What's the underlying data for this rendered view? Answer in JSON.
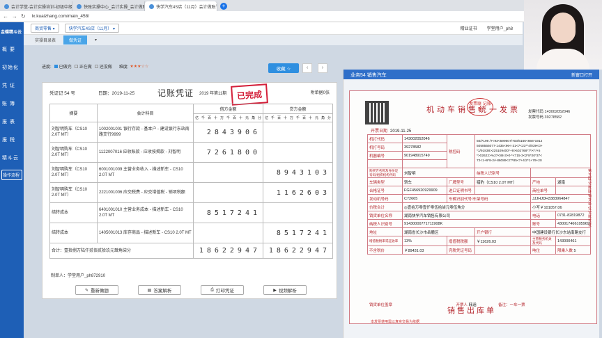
{
  "browser": {
    "tabs": [
      {
        "label": "会计学堂-会计实操培训-初级中级",
        "active": false
      },
      {
        "label": "快账实操中心_会计实操_会计做账",
        "active": false
      },
      {
        "label": "快学汽车4S店（11月）会计做账",
        "active": true
      }
    ],
    "new_tab_glyph": "+",
    "url": "lx.kuaizhang.com/main_458/",
    "back_glyph": "←",
    "forward_glyph": "→",
    "reload_glyph": "↻"
  },
  "sidebar": {
    "logo": "金蝶精斗云",
    "items": [
      "概 要",
      "初始化",
      "凭 证",
      "账 簿",
      "报 表",
      "报 税",
      "精斗云"
    ],
    "process_button": "操作流程"
  },
  "topbar": {
    "mode": "商贸零售",
    "company": "快学汽车4S店（11月）",
    "right_items": [
      "精业证书",
      "学堂用户_ph8"
    ]
  },
  "subtabs": [
    "实操目录表",
    "做凭证"
  ],
  "progress": {
    "label": "进度:",
    "done": "已做完",
    "in_progress": "正在做",
    "not_done": "还没做",
    "difficulty_label": "难度:",
    "stars": "★★★☆☆"
  },
  "collect_button": "收藏 ☆",
  "pager": {
    "prev": "‹",
    "next": "›"
  },
  "voucher": {
    "no": "凭证记 54 号",
    "date": "日期：2019-11-25",
    "title": "记账凭证",
    "period": "2019 年第11期",
    "attachments": "附单据0张",
    "stamp": "已完成",
    "headers": {
      "summary": "摘要",
      "account": "会计科目",
      "debit": "借方金额",
      "credit": "贷方金额"
    },
    "digits": [
      "亿",
      "千",
      "百",
      "十",
      "万",
      "千",
      "百",
      "十",
      "元",
      "角",
      "分"
    ],
    "rows": [
      {
        "summary": "刘智明购车（CS10 2.0T MT）",
        "account": "1002001001 银行存款 - 基本户 - 建设银行东站南路支行9999",
        "debit": "2843906",
        "credit": ""
      },
      {
        "summary": "刘智明购车（CS10 2.0T MT）",
        "account": "1122007016 应收账款 - 应收按揭款 - 刘智明",
        "debit": "7261800",
        "credit": ""
      },
      {
        "summary": "刘智明购车（CS10 2.0T MT）",
        "account": "6001001009 主营业务收入 - 描述新车 - CS10 2.0T MT",
        "debit": "",
        "credit": "8943103"
      },
      {
        "summary": "刘智明购车（CS10 2.0T MT）",
        "account": "2221001006 应交税费 - 应交增值税 - 销项税额",
        "debit": "",
        "credit": "1162603"
      },
      {
        "summary": "结转成本",
        "account": "6401001010 主营业务成本 - 描述新车 - CS10 2.0T MT",
        "debit": "8517241",
        "credit": ""
      },
      {
        "summary": "结转成本",
        "account": "1405001013 库存商品 - 描述新车 - CS10 2.0T MT",
        "debit": "",
        "credit": "8517241"
      }
    ],
    "total_label": "合计：壹拾捌万陆仟贰佰贰拾玖元肆角柒分",
    "total_debit": "18622947",
    "total_credit": "18622947",
    "maker": "制单人：学堂用户_ph872910"
  },
  "actions": [
    {
      "label": "重新做题",
      "icon": "✎"
    },
    {
      "label": "答案解析",
      "icon": "▤"
    },
    {
      "label": "打印凭证",
      "icon": "⎙"
    },
    {
      "label": "视频解析",
      "icon": "▶"
    }
  ],
  "invoice_panel": {
    "header": "业务54 销售汽车",
    "header_right": "新窗口打开",
    "title": "机动车销售统一发票",
    "seal": "发票联 记账联",
    "codes": [
      "发票代码 143002052046",
      "发票号码 39278582"
    ],
    "issue_date_label": "开票日期",
    "issue_date": "2019-11-25",
    "machine_code_label": "机打代码",
    "machine_code": "143002052046",
    "machine_no_label": "机打号码",
    "machine_no": "39278582",
    "device_label": "机器编号",
    "device": "901948915749",
    "tax_area_label": "税控码",
    "tax_area": [
      "50/7199 /7<93<599607/703/6166<666*1912",
      "5058555077-1435<96<-31<7<23**4/039<0>",
      "*1/91838>225109400*+9>502768*7*/<*/+5",
      "*>02622>%27<88-3>0-*<715-3<2*8*20*37<",
      "72<1+6*8-2/+86089<27*85<7+4/2*1+79+20"
    ],
    "buyer_label": "购买方名称及身份证号码/组织机构代码",
    "buyer": "刘智明",
    "tax_id_label": "纳税人识别号",
    "vehicle_type_label": "车辆类型",
    "vehicle_type": "轿车",
    "brand_label": "厂牌型号",
    "brand": "猎豹（CS10 2.0T MT）",
    "origin_label": "产地",
    "origin": "湖南",
    "cert_label": "合格证号",
    "cert": "FGF456920929909",
    "import_label": "进口证明书号",
    "inspect_label": "商检单号",
    "engine_label": "发动机号码",
    "engine": "C72665",
    "vin_label": "车辆识别代号/车架号码",
    "vin": "JJJHJDH3383964847",
    "amount_label": "价税合计",
    "amount_text": "◎壹拾万零壹仟零伍拾柒元零伍角分",
    "amount_small": "小写￥101057.06",
    "seller_label": "销货单位名称",
    "seller": "湖南快学汽车销售有限公司",
    "phone_label": "电话",
    "phone": "0731-82819872",
    "seller_tax_label": "纳税人识别号",
    "seller_tax": "91430000771711908K",
    "account_label": "账号",
    "account": "43001746610596999999",
    "address_label": "地址",
    "address": "湖南省长沙市岳麓区",
    "bank_label": "开户银行",
    "bank": "中国建设银行长沙东站南路支行",
    "vat_rate_label": "增值税税率或征收率",
    "vat_rate": "13%",
    "vat_label": "增值税税额",
    "vat": "￥11626.03",
    "tax_office_label": "主管税务机关及代码",
    "tax_office": "143000461",
    "excl_label": "不含税价",
    "excl": "￥89431.03",
    "cert_no_label": "完税凭证号码",
    "tonnage_label": "吨位",
    "seats_label": "限乘人数",
    "seats": "5",
    "issuer_label": "开票人",
    "issuer": "韩涵",
    "seller_sign": "销货单位盖章",
    "remarks": "备注：一车一票",
    "side_note": "第五联记账联销货单位记账凭证",
    "footer_note": "本发票使用需以真实交易为依据",
    "bottom_title": "销售出库单"
  }
}
